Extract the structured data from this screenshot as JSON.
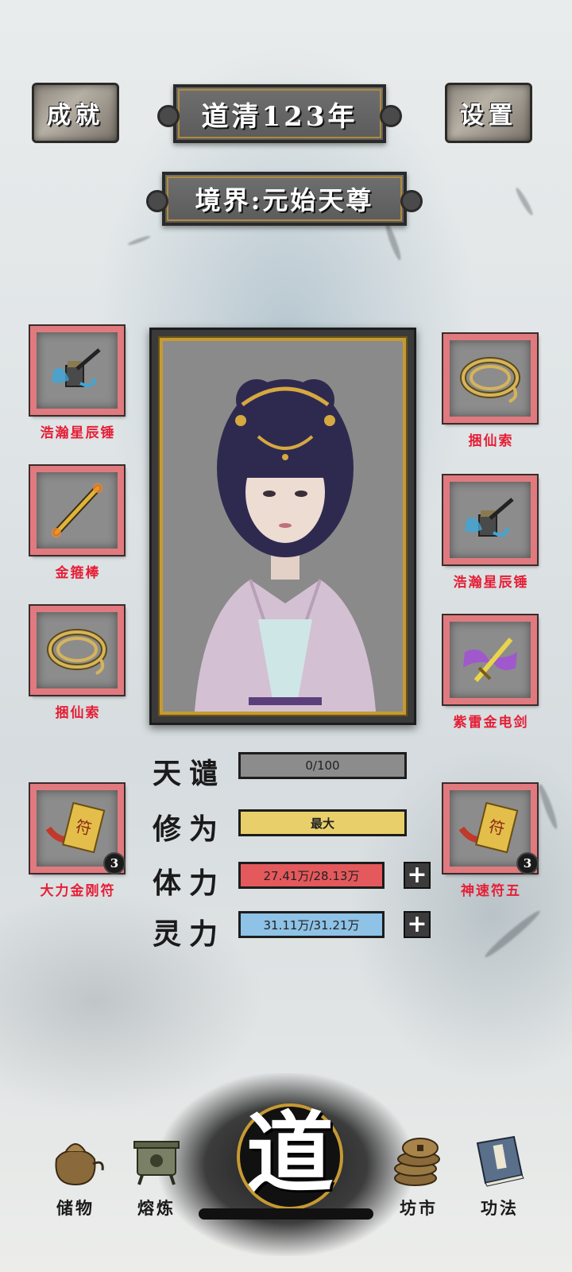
{
  "header": {
    "achievements_label": "成就",
    "year_title": "道清123年",
    "settings_label": "设置"
  },
  "realm": {
    "text": "境界:元始天尊"
  },
  "left_slots": [
    {
      "name": "浩瀚星辰锤",
      "icon": "hammer-icon"
    },
    {
      "name": "金箍棒",
      "icon": "golden-staff-icon"
    },
    {
      "name": "捆仙索",
      "icon": "rope-icon"
    }
  ],
  "right_slots": [
    {
      "name": "捆仙索",
      "icon": "rope-icon"
    },
    {
      "name": "浩瀚星辰锤",
      "icon": "hammer-icon"
    },
    {
      "name": "紫雷金电剑",
      "icon": "lightning-sword-icon"
    }
  ],
  "talismans": {
    "left": {
      "name": "大力金刚符",
      "count": "3",
      "icon": "talisman-icon"
    },
    "right": {
      "name": "神速符五",
      "count": "3",
      "icon": "talisman-icon"
    }
  },
  "stats": {
    "tribulation": {
      "label": "天谴",
      "value": "0/100",
      "fill": 0.0,
      "color": "#8c8c8c"
    },
    "cultivation": {
      "label": "修为",
      "value": "最大",
      "fill": 1.0,
      "color": "#e9cf6a"
    },
    "stamina": {
      "label": "体力",
      "value": "27.41万/28.13万",
      "fill": 0.974,
      "color": "#e4595c"
    },
    "spirit": {
      "label": "灵力",
      "value": "31.11万/31.21万",
      "fill": 0.997,
      "color": "#8ec2e6"
    }
  },
  "nav": {
    "storage": "储物",
    "refine": "熔炼",
    "dao": "道",
    "market": "坊市",
    "techniques": "功法"
  }
}
